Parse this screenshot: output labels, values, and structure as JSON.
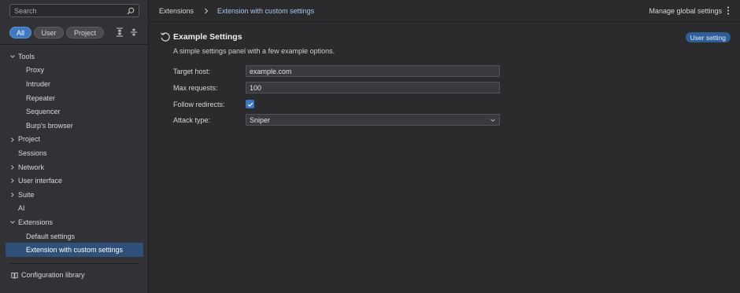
{
  "sidebar": {
    "search": {
      "placeholder": "Search"
    },
    "filters": [
      {
        "label": "All",
        "active": true
      },
      {
        "label": "User",
        "active": false
      },
      {
        "label": "Project",
        "active": false
      }
    ],
    "tree": [
      {
        "label": "Tools",
        "level": 0,
        "expanded": true
      },
      {
        "label": "Proxy",
        "level": 1
      },
      {
        "label": "Intruder",
        "level": 1
      },
      {
        "label": "Repeater",
        "level": 1
      },
      {
        "label": "Sequencer",
        "level": 1
      },
      {
        "label": "Burp's browser",
        "level": 1
      },
      {
        "label": "Project",
        "level": 0,
        "expanded": false
      },
      {
        "label": "Sessions",
        "level": 0
      },
      {
        "label": "Network",
        "level": 0,
        "expanded": false
      },
      {
        "label": "User interface",
        "level": 0,
        "expanded": false
      },
      {
        "label": "Suite",
        "level": 0,
        "expanded": false
      },
      {
        "label": "AI",
        "level": 0
      },
      {
        "label": "Extensions",
        "level": 0,
        "expanded": true
      },
      {
        "label": "Default settings",
        "level": 1
      },
      {
        "label": "Extension with custom settings",
        "level": 1,
        "selected": true
      }
    ],
    "config_library": "Configuration library"
  },
  "topbar": {
    "breadcrumb": [
      "Extensions",
      "Extension with custom settings"
    ],
    "manage_label": "Manage global settings"
  },
  "panel": {
    "title": "Example Settings",
    "badge": "User setting",
    "description": "A simple settings panel with a few example options.",
    "fields": {
      "target_host": {
        "label": "Target host:",
        "value": "example.com"
      },
      "max_requests": {
        "label": "Max requests:",
        "value": "100"
      },
      "follow_redirects": {
        "label": "Follow redirects:",
        "checked": true
      },
      "attack_type": {
        "label": "Attack type:",
        "value": "Sniper"
      }
    }
  },
  "colors": {
    "accent": "#3e79c2",
    "selected_row": "#2e5079",
    "link": "#a9c8ee",
    "badge": "#2f5f98"
  }
}
